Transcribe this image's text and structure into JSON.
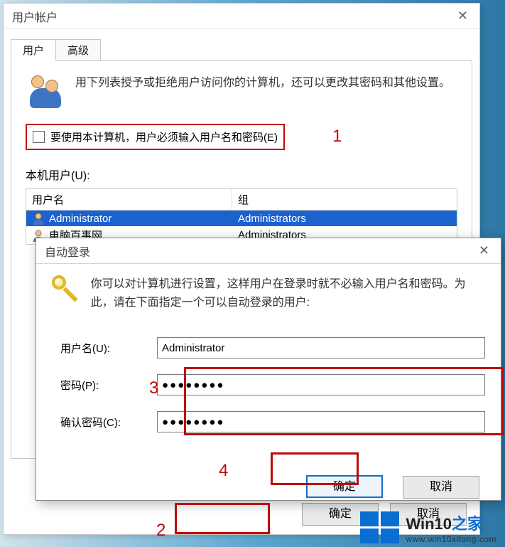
{
  "parent_dialog": {
    "title": "用户帐户",
    "tabs": {
      "user": "用户",
      "advanced": "高级"
    },
    "intro": "用下列表授予或拒绝用户访问你的计算机，还可以更改其密码和其他设置。",
    "checkbox_label": "要使用本计算机，用户必须输入用户名和密码(E)",
    "user_list_label": "本机用户(U):",
    "col_username": "用户名",
    "col_group": "组",
    "rows": [
      {
        "name": "Administrator",
        "group": "Administrators"
      },
      {
        "name": "电脑百事网",
        "group": "Administrators"
      }
    ],
    "ok": "确定",
    "cancel": "取消"
  },
  "child_dialog": {
    "title": "自动登录",
    "intro": "你可以对计算机进行设置，这样用户在登录时就不必输入用户名和密码。为此，请在下面指定一个可以自动登录的用户:",
    "username_label": "用户名(U):",
    "password_label": "密码(P):",
    "confirm_label": "确认密码(C):",
    "username_value": "Administrator",
    "password_value": "●●●●●●●●",
    "confirm_value": "●●●●●●●●",
    "ok": "确定",
    "cancel": "取消"
  },
  "annotations": {
    "1": "1",
    "2": "2",
    "3": "3",
    "4": "4"
  },
  "watermark": {
    "title_a": "Win10",
    "title_b": "之家",
    "url": "www.win10xitong.com"
  }
}
